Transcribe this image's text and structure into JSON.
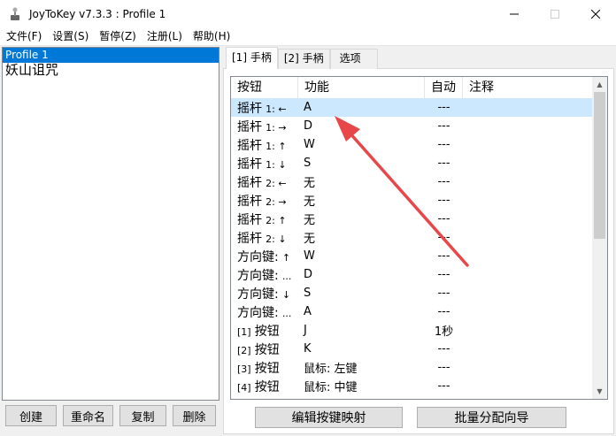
{
  "window": {
    "title": "JoyToKey v7.3.3 : Profile 1"
  },
  "menu": [
    "文件(F)",
    "设置(S)",
    "暂停(Z)",
    "注册(L)",
    "帮助(H)"
  ],
  "profiles": [
    {
      "label": "Profile 1",
      "selected": true
    },
    {
      "label": "妖山诅咒",
      "selected": false
    }
  ],
  "left_buttons": [
    "创建",
    "重命名",
    "复制",
    "删除"
  ],
  "tabs": [
    {
      "label": "[1] 手柄",
      "active": true
    },
    {
      "label": "[2] 手柄",
      "active": false
    },
    {
      "label": "选项",
      "active": false
    }
  ],
  "table": {
    "headers": [
      "按钮",
      "功能",
      "自动",
      "注释"
    ],
    "rows": [
      {
        "button": "摇杆",
        "suffix": "1: ←",
        "func": "A",
        "auto": "---",
        "note": "",
        "selected": true
      },
      {
        "button": "摇杆",
        "suffix": "1: →",
        "func": "D",
        "auto": "---",
        "note": ""
      },
      {
        "button": "摇杆",
        "suffix": "1: ↑",
        "func": "W",
        "auto": "---",
        "note": ""
      },
      {
        "button": "摇杆",
        "suffix": "1: ↓",
        "func": "S",
        "auto": "---",
        "note": ""
      },
      {
        "button": "摇杆",
        "suffix": "2: ←",
        "func": "无",
        "auto": "---",
        "note": ""
      },
      {
        "button": "摇杆",
        "suffix": "2: →",
        "func": "无",
        "auto": "---",
        "note": ""
      },
      {
        "button": "摇杆",
        "suffix": "2: ↑",
        "func": "无",
        "auto": "---",
        "note": ""
      },
      {
        "button": "摇杆",
        "suffix": "2: ↓",
        "func": "无",
        "auto": "---",
        "note": ""
      },
      {
        "button": "方向键:",
        "suffix": "↑",
        "func": "W",
        "auto": "---",
        "note": ""
      },
      {
        "button": "方向键:",
        "suffix": "...",
        "func": "D",
        "auto": "---",
        "note": ""
      },
      {
        "button": "方向键:",
        "suffix": "↓",
        "func": "S",
        "auto": "---",
        "note": ""
      },
      {
        "button": "方向键:",
        "suffix": "...",
        "func": "A",
        "auto": "---",
        "note": ""
      },
      {
        "prefix": "[1]",
        "button": "按钮",
        "func": "J",
        "auto": "1秒",
        "note": ""
      },
      {
        "prefix": "[2]",
        "button": "按钮",
        "func": "K",
        "auto": "---",
        "note": ""
      },
      {
        "prefix": "[3]",
        "button": "按钮",
        "func": "鼠标: 左键",
        "auto": "---",
        "note": ""
      },
      {
        "prefix": "[4]",
        "button": "按钮",
        "func": "鼠标: 中键",
        "auto": "---",
        "note": ""
      }
    ]
  },
  "bottom_buttons": [
    "编辑按键映射",
    "批量分配向导"
  ],
  "colors": {
    "selection": "#0078d7",
    "row_highlight": "#cce8ff",
    "arrow": "#e8474a"
  }
}
